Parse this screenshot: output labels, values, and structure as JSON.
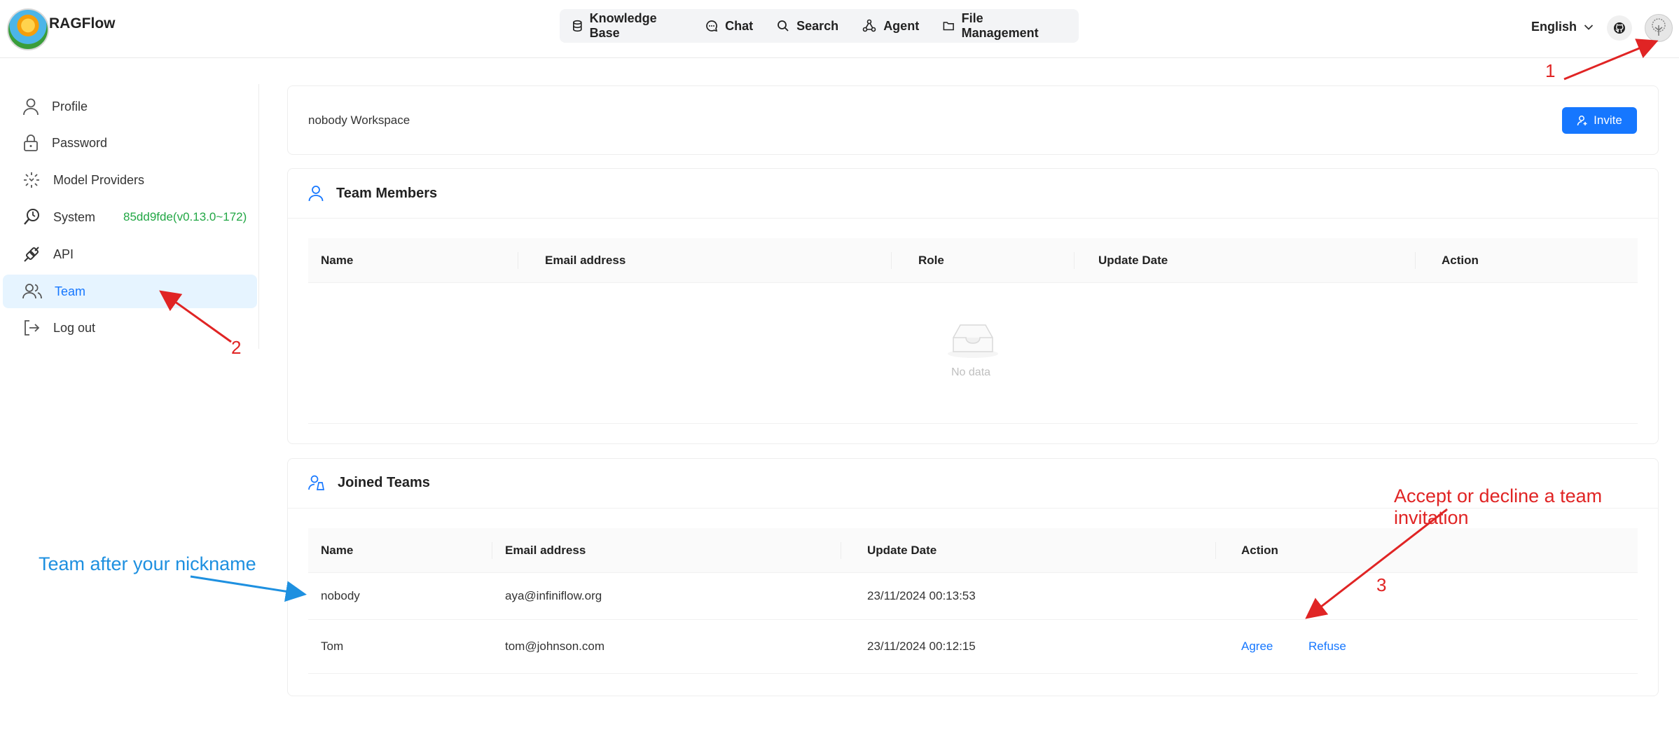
{
  "app": {
    "name": "RAGFlow"
  },
  "nav": {
    "items": [
      {
        "label": "Knowledge Base",
        "icon": "database-icon"
      },
      {
        "label": "Chat",
        "icon": "chat-icon"
      },
      {
        "label": "Search",
        "icon": "search-icon"
      },
      {
        "label": "Agent",
        "icon": "agent-icon"
      },
      {
        "label": "File Management",
        "icon": "folder-icon"
      }
    ]
  },
  "header": {
    "language": "English"
  },
  "sidebar": {
    "items": [
      {
        "label": "Profile",
        "icon": "user-icon"
      },
      {
        "label": "Password",
        "icon": "lock-icon"
      },
      {
        "label": "Model Providers",
        "icon": "model-icon"
      },
      {
        "label": "System",
        "icon": "system-icon",
        "extra": "85dd9fde(v0.13.0~172)"
      },
      {
        "label": "API",
        "icon": "api-icon"
      },
      {
        "label": "Team",
        "icon": "team-icon",
        "active": true
      },
      {
        "label": "Log out",
        "icon": "logout-icon"
      }
    ]
  },
  "workspace": {
    "name": "nobody Workspace",
    "invite_label": "Invite"
  },
  "team_members": {
    "title": "Team Members",
    "columns": [
      "Name",
      "Email address",
      "Role",
      "Update Date",
      "Action"
    ],
    "empty_text": "No data"
  },
  "joined_teams": {
    "title": "Joined Teams",
    "columns": [
      "Name",
      "Email address",
      "Update Date",
      "Action"
    ],
    "rows": [
      {
        "name": "nobody",
        "email": "aya@infiniflow.org",
        "date": "23/11/2024 00:13:53"
      },
      {
        "name": "Tom",
        "email": "tom@johnson.com",
        "date": "23/11/2024 00:12:15",
        "agree": "Agree",
        "refuse": "Refuse"
      }
    ]
  },
  "annotations": {
    "n1": "1",
    "n2": "2",
    "n3": "3",
    "accept": "Accept or decline a team invitation",
    "team_after": "Team after your nickname",
    "red": "#e02424",
    "blue": "#1e90e0"
  }
}
